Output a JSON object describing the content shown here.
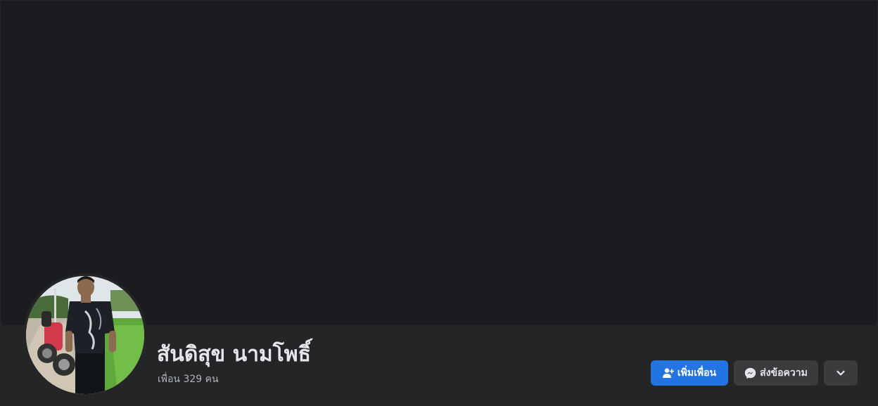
{
  "profile": {
    "name": "สันดิสุข นามโพธิ์",
    "friends_text": "เพื่อน 329 คน"
  },
  "actions": {
    "add_friend_label": "เพิ่มเพื่อน",
    "message_label": "ส่งข้อความ"
  },
  "icons": {
    "add_friend": "person-add-icon",
    "message": "messenger-icon",
    "more": "chevron-down-icon"
  },
  "colors": {
    "background": "#242526",
    "cover": "#1b1c1f",
    "primary": "#2374e1",
    "secondary_button": "#3a3b3c",
    "text_primary": "#e4e6eb",
    "text_secondary": "#b0b3b8"
  }
}
